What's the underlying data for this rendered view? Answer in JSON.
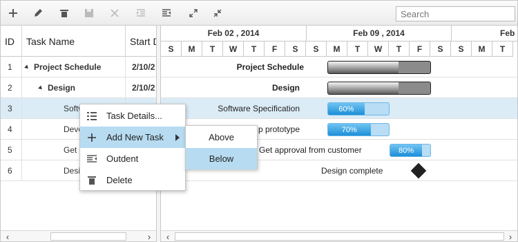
{
  "toolbar": {
    "buttons": [
      {
        "name": "add-icon",
        "enabled": true
      },
      {
        "name": "edit-icon",
        "enabled": true
      },
      {
        "name": "delete-icon",
        "enabled": true
      },
      {
        "name": "save-icon",
        "enabled": false
      },
      {
        "name": "cancel-icon",
        "enabled": false
      },
      {
        "name": "indent-icon",
        "enabled": false
      },
      {
        "name": "outdent-icon",
        "enabled": true
      },
      {
        "name": "expand-all-icon",
        "enabled": true
      },
      {
        "name": "collapse-all-icon",
        "enabled": true
      }
    ],
    "search_placeholder": "Search"
  },
  "grid": {
    "headers": {
      "id": "ID",
      "task_name": "Task Name",
      "start_date": "Start D"
    },
    "rows": [
      {
        "id": "1",
        "name": "Project Schedule",
        "start": "2/10/2",
        "bold": true,
        "expander": true,
        "indent": 0
      },
      {
        "id": "2",
        "name": "Design",
        "start": "2/10/2",
        "bold": true,
        "expander": true,
        "indent": 1
      },
      {
        "id": "3",
        "name": "Softw",
        "start": "",
        "bold": false,
        "expander": false,
        "indent": 2,
        "selected": true
      },
      {
        "id": "4",
        "name": "Deve",
        "start": "",
        "bold": false,
        "expander": false,
        "indent": 2
      },
      {
        "id": "5",
        "name": "Get a",
        "start": "",
        "bold": false,
        "expander": false,
        "indent": 2
      },
      {
        "id": "6",
        "name": "Desig",
        "start": "",
        "bold": false,
        "expander": false,
        "indent": 2
      }
    ]
  },
  "timeline": {
    "weeks": [
      "Feb 02 , 2014",
      "Feb 09 , 2014",
      "Feb 1"
    ],
    "days": [
      "S",
      "M",
      "T",
      "W",
      "T",
      "F",
      "S",
      "S",
      "M",
      "T",
      "W",
      "T",
      "F",
      "S",
      "S",
      "M",
      "T"
    ]
  },
  "chart": {
    "rows": [
      {
        "label": "Project Schedule",
        "type": "parent",
        "progress": 0.69
      },
      {
        "label": "Design",
        "type": "parent",
        "progress": 0.69
      },
      {
        "label": "Software Specification",
        "type": "task",
        "progress_text": "60%",
        "progress": 0.6
      },
      {
        "label": "p prototype",
        "type": "task",
        "progress_text": "70%",
        "progress": 0.7
      },
      {
        "label": "Get approval from customer",
        "type": "task",
        "progress_text": "80%",
        "progress": 0.8
      },
      {
        "label": "Design complete",
        "type": "milestone"
      }
    ]
  },
  "context_menu": {
    "items": [
      {
        "label": "Task Details...",
        "icon": "task-details-icon"
      },
      {
        "label": "Add New Task",
        "icon": "add-icon",
        "has_submenu": true,
        "highlighted": true
      },
      {
        "label": "Outdent",
        "icon": "outdent-icon"
      },
      {
        "label": "Delete",
        "icon": "delete-icon"
      }
    ],
    "submenu": [
      {
        "label": "Above"
      },
      {
        "label": "Below",
        "highlighted": true
      }
    ]
  },
  "colors": {
    "selection": "#dbecf7",
    "menu_highlight": "#b7dcf1",
    "task_fill": "#1e8fd8",
    "task_track": "#b8ddf4"
  }
}
